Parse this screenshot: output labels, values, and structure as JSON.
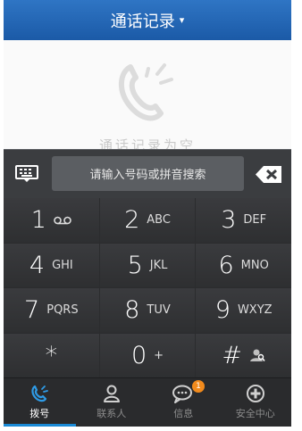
{
  "header": {
    "title": "通话记录",
    "caret": "▾"
  },
  "empty_state": {
    "icon": "call-log-empty-icon",
    "text": "通话记录为空"
  },
  "search": {
    "placeholder": "请输入号码或拼音搜索",
    "keyboard_icon": "keyboard-icon",
    "delete_icon": "backspace-icon"
  },
  "keypad": {
    "keys": [
      {
        "digit": "1",
        "letters": "",
        "icon": "voicemail-icon"
      },
      {
        "digit": "2",
        "letters": "ABC"
      },
      {
        "digit": "3",
        "letters": "DEF"
      },
      {
        "digit": "4",
        "letters": "GHI"
      },
      {
        "digit": "5",
        "letters": "JKL"
      },
      {
        "digit": "6",
        "letters": "MNO"
      },
      {
        "digit": "7",
        "letters": "PQRS"
      },
      {
        "digit": "8",
        "letters": "TUV"
      },
      {
        "digit": "9",
        "letters": "WXYZ"
      },
      {
        "digit": "*",
        "letters": ""
      },
      {
        "digit": "0",
        "letters": "+"
      },
      {
        "digit": "#",
        "letters": "",
        "icon": "person-search-icon"
      }
    ]
  },
  "tabs": [
    {
      "label": "拨号",
      "icon": "dialer-icon",
      "active": true
    },
    {
      "label": "联系人",
      "icon": "contacts-icon"
    },
    {
      "label": "信息",
      "icon": "messages-icon",
      "badge": "1"
    },
    {
      "label": "安全中心",
      "icon": "security-center-icon"
    }
  ],
  "colors": {
    "header": "#1b5aa7",
    "accent": "#1a8ad6",
    "badge": "#f18a1c"
  }
}
